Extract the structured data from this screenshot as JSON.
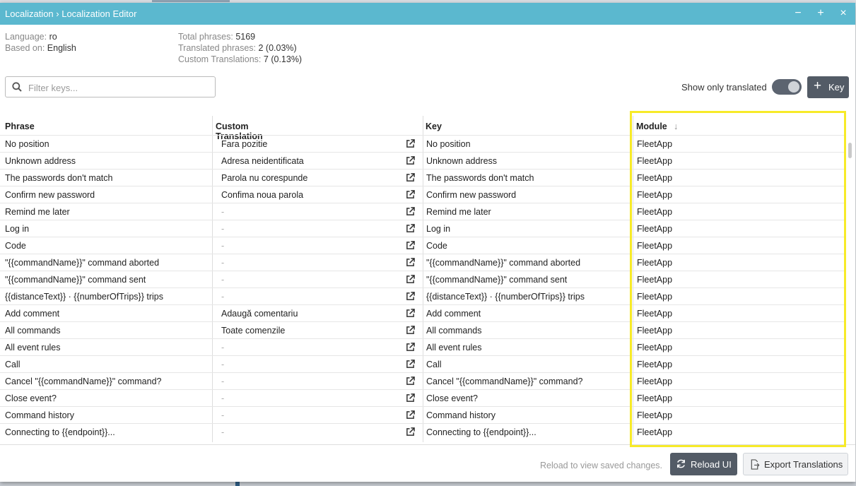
{
  "window": {
    "breadcrumb": "Localization › Localization Editor",
    "minimize": "−",
    "maximize": "+",
    "close": "×"
  },
  "info": {
    "language_label": "Language:",
    "language_value": "ro",
    "based_label": "Based on:",
    "based_value": "English",
    "total_label": "Total phrases:",
    "total_value": "5169",
    "translated_label": "Translated phrases:",
    "translated_value": "2 (0.03%)",
    "custom_label": "Custom Translations:",
    "custom_value": "7 (0.13%)"
  },
  "toolbar": {
    "filter_placeholder": "Filter keys...",
    "show_only_translated": "Show only translated",
    "toggle_on": true,
    "key_button": "Key"
  },
  "table": {
    "columns": [
      "Phrase",
      "Custom Translation",
      "Key",
      "Module"
    ],
    "sort_indicator": "↓",
    "rows": [
      {
        "phrase": "No position",
        "custom": "Fara pozitie",
        "key": "No position",
        "module": "FleetApp"
      },
      {
        "phrase": "Unknown address",
        "custom": "Adresa neidentificata",
        "key": "Unknown address",
        "module": "FleetApp"
      },
      {
        "phrase": "The passwords don't match",
        "custom": "Parola nu corespunde",
        "key": "The passwords don't match",
        "module": "FleetApp"
      },
      {
        "phrase": "Confirm new password",
        "custom": "Confima noua parola",
        "key": "Confirm new password",
        "module": "FleetApp"
      },
      {
        "phrase": "Remind me later",
        "custom": "-",
        "key": "Remind me later",
        "module": "FleetApp"
      },
      {
        "phrase": "Log in",
        "custom": "-",
        "key": "Log in",
        "module": "FleetApp"
      },
      {
        "phrase": "Code",
        "custom": "-",
        "key": "Code",
        "module": "FleetApp"
      },
      {
        "phrase": "\"{{commandName}}\" command aborted",
        "custom": "-",
        "key": "\"{{commandName}}\" command aborted",
        "module": "FleetApp"
      },
      {
        "phrase": "\"{{commandName}}\" command sent",
        "custom": "-",
        "key": "\"{{commandName}}\" command sent",
        "module": "FleetApp"
      },
      {
        "phrase": "{{distanceText}} · {{numberOfTrips}} trips",
        "custom": "-",
        "key": "{{distanceText}} · {{numberOfTrips}} trips",
        "module": "FleetApp"
      },
      {
        "phrase": "Add comment",
        "custom": "Adaugă comentariu",
        "key": "Add comment",
        "module": "FleetApp"
      },
      {
        "phrase": "All commands",
        "custom": "Toate comenzile",
        "key": "All commands",
        "module": "FleetApp"
      },
      {
        "phrase": "All event rules",
        "custom": "-",
        "key": "All event rules",
        "module": "FleetApp"
      },
      {
        "phrase": "Call",
        "custom": "-",
        "key": "Call",
        "module": "FleetApp"
      },
      {
        "phrase": "Cancel \"{{commandName}}\" command?",
        "custom": "-",
        "key": "Cancel \"{{commandName}}\" command?",
        "module": "FleetApp"
      },
      {
        "phrase": "Close event?",
        "custom": "-",
        "key": "Close event?",
        "module": "FleetApp"
      },
      {
        "phrase": "Command history",
        "custom": "-",
        "key": "Command history",
        "module": "FleetApp"
      },
      {
        "phrase": "Connecting to {{endpoint}}...",
        "custom": "-",
        "key": "Connecting to {{endpoint}}...",
        "module": "FleetApp"
      }
    ]
  },
  "footer": {
    "hint": "Reload to view saved changes.",
    "reload_button": "Reload UI",
    "export_button": "Export Translations"
  },
  "colors": {
    "titlebar": "#5bb8cf",
    "button_dark": "#535b66",
    "highlight": "#f7ea28"
  },
  "icons": [
    "search-icon",
    "plus-icon",
    "external-link-icon",
    "sort-down-icon",
    "refresh-icon",
    "export-icon"
  ]
}
